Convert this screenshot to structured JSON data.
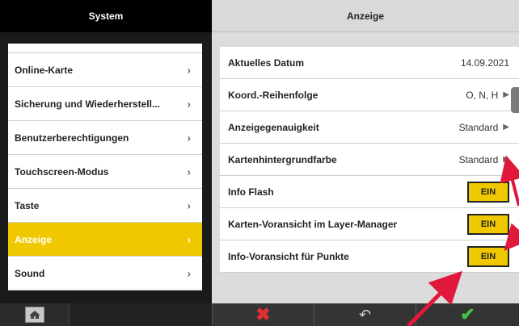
{
  "left_panel": {
    "title": "System",
    "items": [
      {
        "label": ""
      },
      {
        "label": "Online-Karte"
      },
      {
        "label": "Sicherung und Wiederherstell..."
      },
      {
        "label": "Benutzerberechtigungen"
      },
      {
        "label": "Touchscreen-Modus"
      },
      {
        "label": "Taste"
      },
      {
        "label": "Anzeige",
        "active": true
      },
      {
        "label": "Sound"
      }
    ]
  },
  "right_panel": {
    "title": "Anzeige",
    "rows": [
      {
        "label": "Aktuelles Datum",
        "value": "14.09.2021"
      },
      {
        "label": "Koord.-Reihenfolge",
        "value": "O, N, H"
      },
      {
        "label": "Anzeigegenauigkeit",
        "value": "Standard"
      },
      {
        "label": "Kartenhintergrundfarbe",
        "value": "Standard"
      },
      {
        "label": "Info Flash",
        "toggle": "EIN"
      },
      {
        "label": "Karten-Voransicht im Layer-Manager",
        "toggle": "EIN"
      },
      {
        "label": "Info-Voransicht für Punkte",
        "toggle": "EIN"
      }
    ]
  },
  "bottom_bar": {
    "icons": [
      "home-icon",
      "close-icon",
      "undo-icon",
      "check-icon"
    ]
  },
  "colors": {
    "accent": "#f0c800",
    "annotation": "#e0193c",
    "cancel": "#e03030",
    "confirm": "#46c048"
  }
}
